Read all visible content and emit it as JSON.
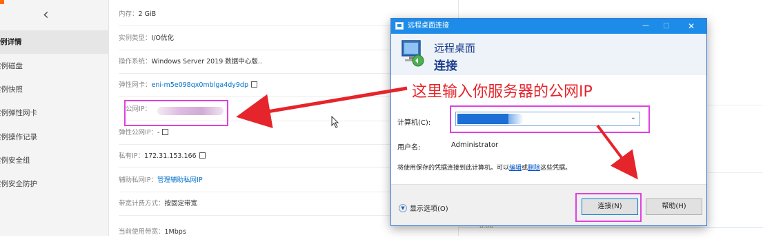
{
  "sidebar": {
    "back_icon": "chevron-left-icon",
    "items": [
      {
        "label": "例详情",
        "active": true
      },
      {
        "label": "实例磁盘"
      },
      {
        "label": "实例快照"
      },
      {
        "label": "实例弹性网卡"
      },
      {
        "label": "实例操作记录"
      },
      {
        "label": "实例安全组"
      },
      {
        "label": "实例安全防护"
      }
    ]
  },
  "info": {
    "memory": {
      "label": "内存：",
      "value": "2 GiB"
    },
    "instance_type": {
      "label": "实例类型：",
      "value": "I/O优化"
    },
    "os": {
      "label": "操作系统：",
      "value": "Windows Server 2019 数据中心版.."
    },
    "eni": {
      "label": "弹性网卡：",
      "value": "eni-m5e098qx0mblga4dy9dp"
    },
    "public_ip": {
      "label": "公网IP："
    },
    "elastic_ip": {
      "label": "弹性公网IP：",
      "value": "-"
    },
    "private_ip": {
      "label": "私有IP：",
      "value": "172.31.153.166"
    },
    "secondary_ip": {
      "label": "辅助私网IP：",
      "value": "管理辅助私网IP"
    },
    "billing": {
      "label": "带宽计费方式：",
      "value": "按固定带宽"
    },
    "current_bw": {
      "label": "当前使用带宽：",
      "value": "1Mbps"
    }
  },
  "chart": {
    "zero_label": "0.00"
  },
  "dialog": {
    "title": "远程桌面连接",
    "header_line1": "远程桌面",
    "header_line2": "连接",
    "computer_label": "计算机(C):",
    "username_label": "用户名:",
    "username_value": "Administrator",
    "notice_prefix": "将使用保存的凭据连接到此计算机。可以",
    "notice_edit": "编辑",
    "notice_or": "或",
    "notice_delete": "删除",
    "notice_suffix": "这些凭据。",
    "show_options": "显示选项(O)",
    "connect_button": "连接(N)",
    "help_button": "帮助(H)"
  },
  "annotation": {
    "caption": "这里输入你服务器的公网IP",
    "color": "#e6242b",
    "highlight_color": "#e040e0"
  }
}
